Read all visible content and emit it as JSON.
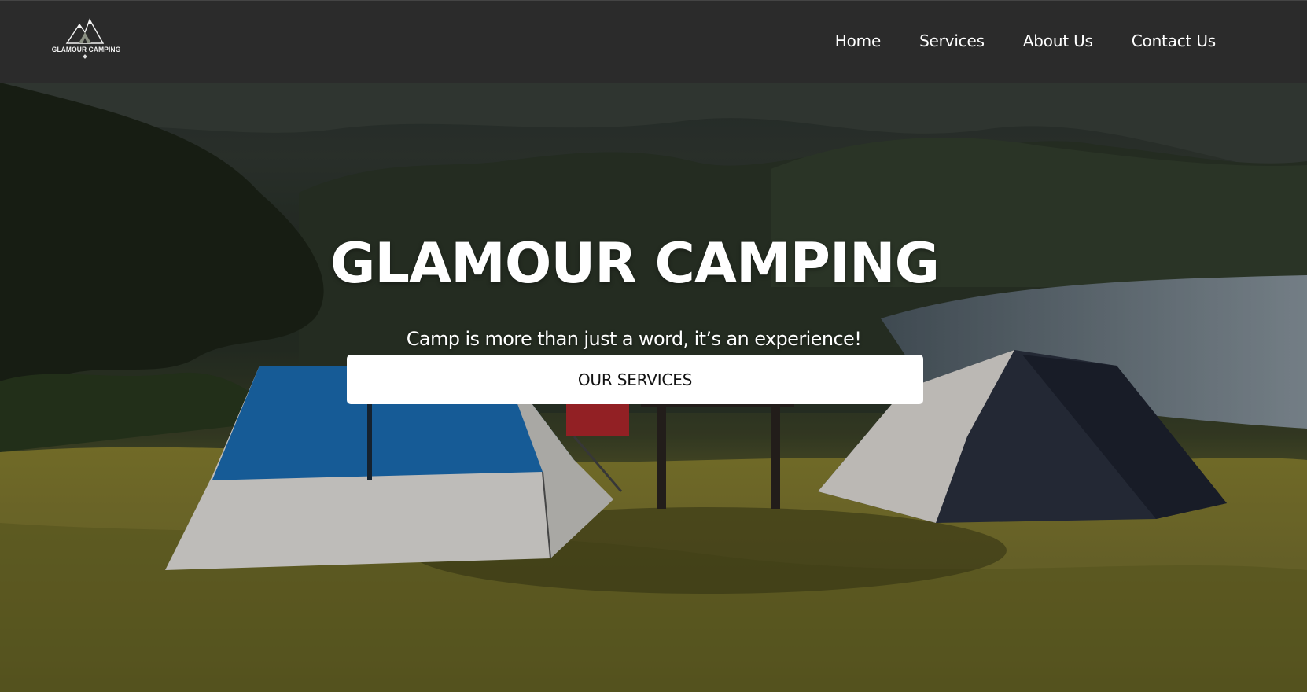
{
  "brand": {
    "logo_text": "GLAMOUR CAMPING"
  },
  "nav": {
    "items": [
      {
        "label": "Home"
      },
      {
        "label": "Services"
      },
      {
        "label": "About Us"
      },
      {
        "label": "Contact Us"
      }
    ]
  },
  "hero": {
    "title": "GLAMOUR CAMPING",
    "subtitle": "Camp is more than just a word, it’s an experience!",
    "cta_label": "OUR SERVICES"
  },
  "colors": {
    "navbar_bg": "#2b2b2b",
    "nav_text": "#ffffff",
    "cta_bg": "#ffffff",
    "cta_text": "#111111"
  }
}
